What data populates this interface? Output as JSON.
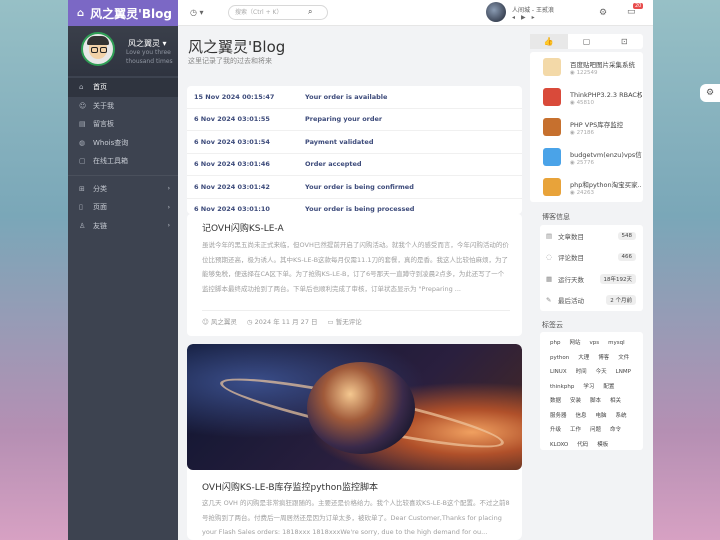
{
  "site": {
    "brand": "风之翼灵'Blog",
    "home_icon": "home-icon"
  },
  "profile": {
    "name": "风之翼灵",
    "motto": "Love you three thousand times"
  },
  "nav": [
    {
      "label": "首页",
      "icon": "home-icon"
    },
    {
      "label": "关于我",
      "icon": "user-icon"
    },
    {
      "label": "留言板",
      "icon": "message-icon"
    },
    {
      "label": "Whois查询",
      "icon": "globe-icon"
    },
    {
      "label": "在线工具箱",
      "icon": "tools-icon"
    },
    {
      "label": "分类",
      "icon": "grid-icon"
    },
    {
      "label": "页面",
      "icon": "page-icon"
    },
    {
      "label": "友链",
      "icon": "link-icon"
    }
  ],
  "search": {
    "placeholder": "搜索（Ctrl + K）"
  },
  "music": {
    "title": "人间城 - 王贰浪"
  },
  "notify_badge": "20",
  "page": {
    "title": "风之翼灵'Blog",
    "subtitle": "这里记录了我的过去和将来"
  },
  "timeline": [
    {
      "time": "15 Nov 2024 00:15:47",
      "event": "Your order is available"
    },
    {
      "time": "6 Nov 2024 03:01:55",
      "event": "Preparing your order"
    },
    {
      "time": "6 Nov 2024 03:01:54",
      "event": "Payment validated"
    },
    {
      "time": "6 Nov 2024 03:01:46",
      "event": "Order accepted"
    },
    {
      "time": "6 Nov 2024 03:01:42",
      "event": "Your order is being confirmed"
    },
    {
      "time": "6 Nov 2024 03:01:10",
      "event": "Your order is being processed"
    }
  ],
  "post1": {
    "title": "记OVH闪购KS-LE-A",
    "body": "虽说今年的黑五尚未正式来临，但OVH已然提前开启了闪购活动。就我个人的感受而言，今年闪购活动的价位比预期还高，极为诱人。其中KS-LE-B这款每月仅需11.1刀的套餐，真的是香。我这人比较怕麻烦，为了能够免税，便选择在CA区下单。为了抢购KS-LE-B，订了6号那天一直蹲守到凌晨2点多，为此还写了一个监控脚本最终成功抢到了两台。下单后也顺利完成了审核，订单状态显示为 \"Preparing ...",
    "author": "风之翼灵",
    "date": "2024 年 11 月 27 日",
    "comments": "暂无评论"
  },
  "post2": {
    "title": "OVH闪购KS-LE-B库存监控python监控脚本",
    "body": "这几天 OVH 的闪购是非常疯狂跟随的。主要还是价格给力。我个人比较喜欢KS-LE-B这个配置。不过之前8号抢购到了两台。付费后一周居然还是因为订单太多，被砍单了。Dear Customer,Thanks for placing your Flash Sales orders: 1818xxx 1818xxxWe're sorry, due to the high demand for ou..."
  },
  "right_tabs": [
    "thumb-up-icon",
    "chat-icon",
    "gift-icon"
  ],
  "right_posts": [
    {
      "title": "百度贴吧图片采集系统",
      "views": "122549"
    },
    {
      "title": "ThinkPHP3.2.3 RBAC权限...",
      "views": "45810"
    },
    {
      "title": "PHP VPS库存监控",
      "views": "27186"
    },
    {
      "title": "budgetvm(enzu)vps信...",
      "views": "25776"
    },
    {
      "title": "php和python淘宝买家...",
      "views": "24263"
    }
  ],
  "info": {
    "heading": "博客信息",
    "items": [
      {
        "label": "文章数目",
        "value": "548"
      },
      {
        "label": "评论数目",
        "value": "466"
      },
      {
        "label": "运行天数",
        "value": "18年192天"
      },
      {
        "label": "最后活动",
        "value": "2 个月前"
      }
    ]
  },
  "tags": {
    "heading": "标签云",
    "items": [
      "php",
      "网站",
      "vps",
      "mysql",
      "python",
      "大理",
      "博客",
      "文件",
      "LINUX",
      "时间",
      "今天",
      "LNMP",
      "thinkphp",
      "学习",
      "配置",
      "数据",
      "安装",
      "脚本",
      "相关",
      "服务器",
      "信息",
      "电脑",
      "系统",
      "升级",
      "工作",
      "问题",
      "命令",
      "KLOXO",
      "代码",
      "模板"
    ]
  }
}
